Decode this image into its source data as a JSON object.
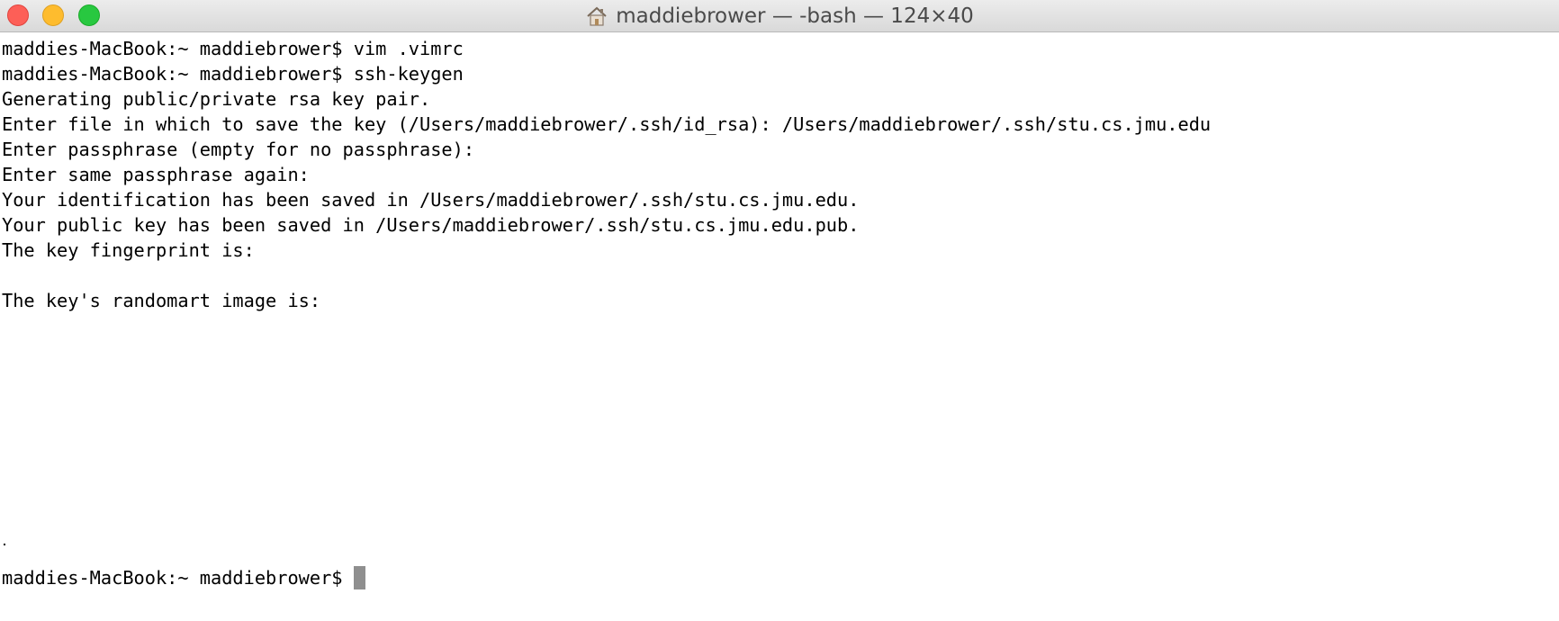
{
  "window": {
    "title": "maddiebrower — -bash — 124×40",
    "title_icon": "home-icon"
  },
  "terminal": {
    "lines": [
      "maddies-MacBook:~ maddiebrower$ vim .vimrc",
      "maddies-MacBook:~ maddiebrower$ ssh-keygen",
      "Generating public/private rsa key pair.",
      "Enter file in which to save the key (/Users/maddiebrower/.ssh/id_rsa): /Users/maddiebrower/.ssh/stu.cs.jmu.edu",
      "Enter passphrase (empty for no passphrase):",
      "Enter same passphrase again:",
      "Your identification has been saved in /Users/maddiebrower/.ssh/stu.cs.jmu.edu.",
      "Your public key has been saved in /Users/maddiebrower/.ssh/stu.cs.jmu.edu.pub.",
      "The key fingerprint is:"
    ],
    "randomart_heading": "The key's randomart image is:",
    "prompt": "maddies-MacBook:~ maddiebrower$ "
  },
  "colors": {
    "background": "#ffffff",
    "text": "#000000",
    "cursor": "#8f8f8f",
    "close": "#fd5f57",
    "minimize": "#febc2e",
    "zoom": "#28c840"
  }
}
